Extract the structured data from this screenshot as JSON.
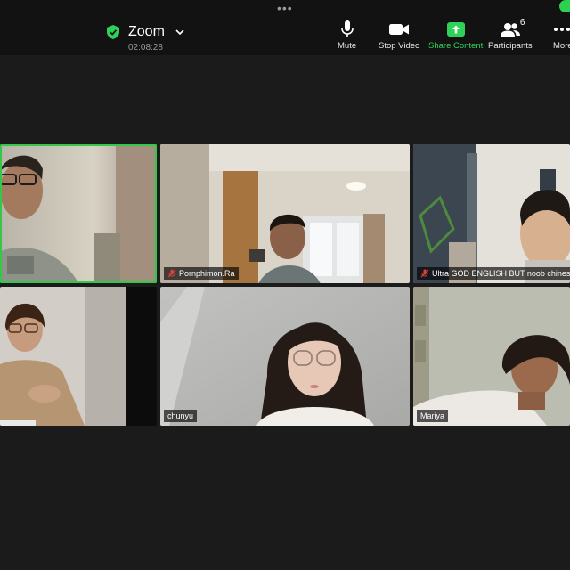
{
  "header": {
    "app_title": "Zoom",
    "timer": "02:08:28"
  },
  "toolbar": {
    "mute_label": "Mute",
    "stop_video_label": "Stop Video",
    "share_label": "Share Content",
    "participants_label": "Participants",
    "participants_count": "6",
    "more_label": "More"
  },
  "tiles": [
    {
      "name": "",
      "muted": false,
      "active": true
    },
    {
      "name": "Pornphimon.Ra",
      "muted": true,
      "active": false
    },
    {
      "name": "Ultra  GOD ENGLISH BUT noob chinese",
      "muted": true,
      "active": false
    },
    {
      "name": "",
      "muted": false,
      "active": false
    },
    {
      "name": "chunyu",
      "muted": false,
      "active": false
    },
    {
      "name": "Mariya",
      "muted": false,
      "active": false
    }
  ],
  "colors": {
    "background": "#1b1b1b",
    "topbar": "#121212",
    "accent_green": "#2fd259",
    "active_border": "#33c84a",
    "mute_red": "#e0423a"
  }
}
